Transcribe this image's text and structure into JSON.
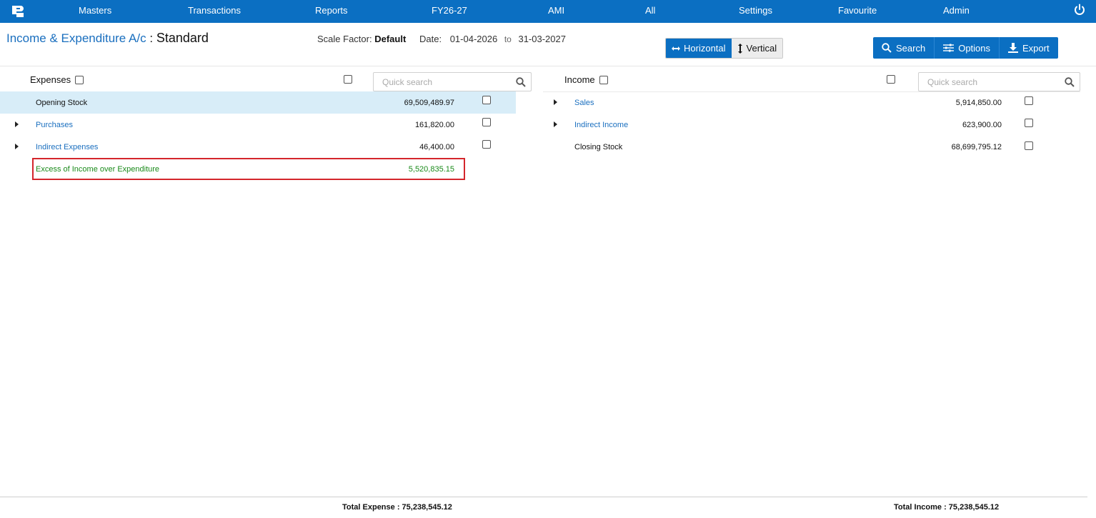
{
  "nav": {
    "items": [
      "Masters",
      "Transactions",
      "Reports",
      "FY26-27",
      "AMI",
      "All",
      "Settings",
      "Favourite",
      "Admin"
    ]
  },
  "header": {
    "title": "Income & Expenditure A/c",
    "title_sep": ":",
    "variant": "Standard",
    "scale_label": "Scale Factor:",
    "scale_value": "Default",
    "date_label": "Date:",
    "date_from": "01-04-2026",
    "date_to_label": "to",
    "date_to": "31-03-2027"
  },
  "view_toggle": {
    "horizontal": "Horizontal",
    "vertical": "Vertical"
  },
  "actions": {
    "search": "Search",
    "options": "Options",
    "export": "Export"
  },
  "expenses": {
    "heading": "Expenses",
    "search_placeholder": "Quick search",
    "rows": [
      {
        "label": "Opening Stock",
        "amount": "69,509,489.97"
      },
      {
        "label": "Purchases",
        "amount": "161,820.00"
      },
      {
        "label": "Indirect Expenses",
        "amount": "46,400.00"
      },
      {
        "label": "Excess of Income over Expenditure",
        "amount": "5,520,835.15"
      }
    ],
    "total": "Total Expense : 75,238,545.12"
  },
  "income": {
    "heading": "Income",
    "search_placeholder": "Quick search",
    "rows": [
      {
        "label": "Sales",
        "amount": "5,914,850.00"
      },
      {
        "label": "Indirect Income",
        "amount": "623,900.00"
      },
      {
        "label": "Closing Stock",
        "amount": "68,699,795.12"
      }
    ],
    "total": "Total Income : 75,238,545.12"
  },
  "colors": {
    "nav_bg": "#0b6fc2",
    "link": "#1a6fbf",
    "highlight_row": "#d8edf8",
    "surplus_green": "#1a8a1a",
    "red_outline": "#d4262c"
  }
}
